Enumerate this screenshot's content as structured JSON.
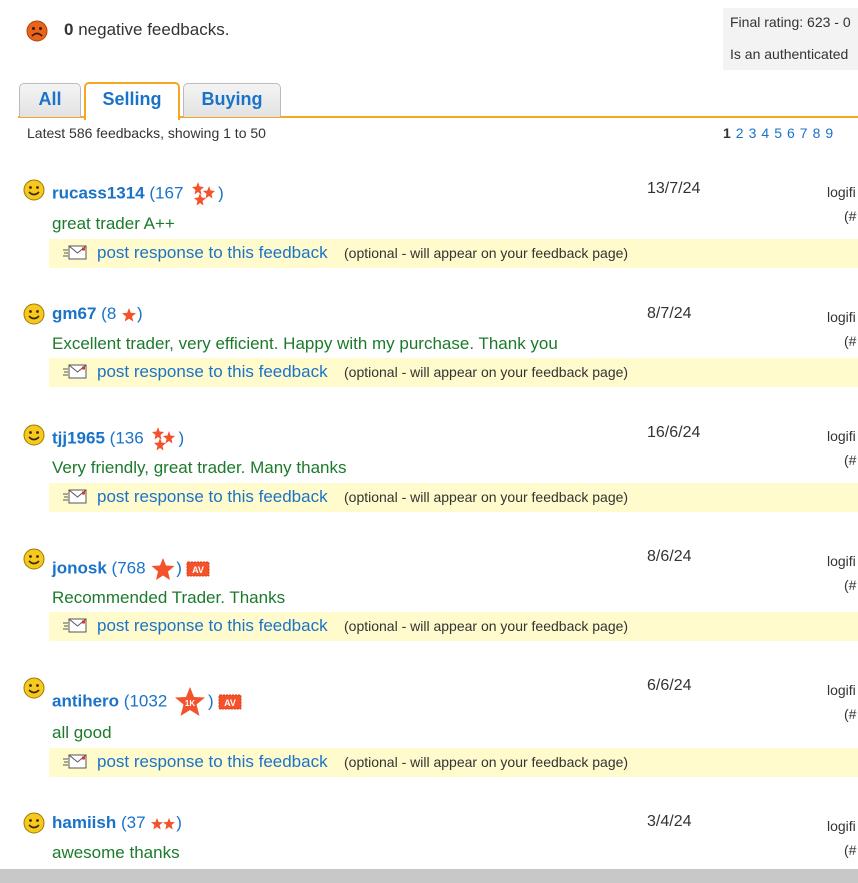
{
  "header": {
    "negative_count": "0",
    "negative_text": "negative feedbacks.",
    "final_rating": "Final rating: 623 - 0",
    "authenticated": "Is an authenticated"
  },
  "tabs": [
    {
      "label": "All"
    },
    {
      "label": "Selling"
    },
    {
      "label": "Buying"
    }
  ],
  "summary": "Latest 586 feedbacks, showing 1 to 50",
  "pages": [
    "1",
    "2",
    "3",
    "4",
    "5",
    "6",
    "7",
    "8",
    "9"
  ],
  "response_link": "post response to this feedback",
  "response_note": "(optional - will appear on your feedback page)",
  "entries": [
    {
      "user": "rucass1314",
      "count": "167",
      "date": "13/7/24",
      "right1": "logifi",
      "right2": "(#",
      "comment": "great trader A++"
    },
    {
      "user": "gm67",
      "count": "8",
      "date": "8/7/24",
      "right1": "logifi",
      "right2": "(#",
      "comment": "Excellent trader, very efficient. Happy with my purchase. Thank you"
    },
    {
      "user": "tjj1965",
      "count": "136",
      "date": "16/6/24",
      "right1": "logifi",
      "right2": "(#",
      "comment": "Very friendly,  great trader.  Many thanks"
    },
    {
      "user": "jonosk",
      "count": "768",
      "date": "8/6/24",
      "right1": "logifi",
      "right2": "(#",
      "comment": "Recommended Trader. Thanks",
      "av": "AV"
    },
    {
      "user": "antihero",
      "count": "1032",
      "date": "6/6/24",
      "right1": "logifi",
      "right2": "(#",
      "comment": "all good",
      "av": "AV",
      "badge": "1K"
    },
    {
      "user": "hamiish",
      "count": "37",
      "date": "3/4/24",
      "right1": "logifi",
      "right2": "(#",
      "comment": "awesome thanks"
    }
  ]
}
